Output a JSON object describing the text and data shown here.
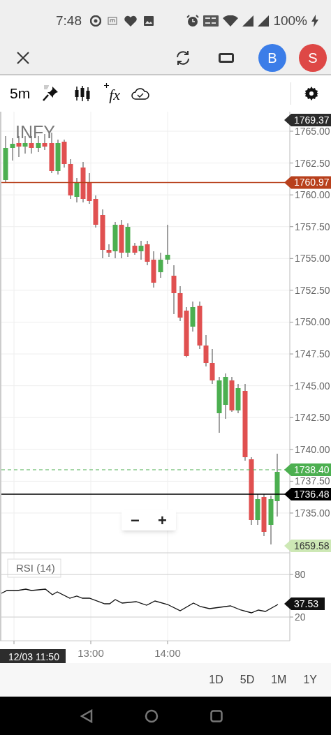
{
  "status_bar": {
    "time": "7:48",
    "battery": "100%"
  },
  "app_bar": {
    "avatars": [
      {
        "letter": "B",
        "color": "#3b7de8"
      },
      {
        "letter": "S",
        "color": "#de4846"
      }
    ]
  },
  "toolbar": {
    "interval": "5m",
    "indicators_label": "fx"
  },
  "chart": {
    "symbol": "INFY",
    "price_ticks": [
      "1765.00",
      "1762.50",
      "1760.00",
      "1757.50",
      "1755.00",
      "1752.50",
      "1750.00",
      "1747.50",
      "1745.00",
      "1742.50",
      "1740.00",
      "1737.50",
      "1735.00"
    ],
    "price_tags": [
      {
        "label": "1769.37",
        "kind": "plain",
        "color": "#2b2b2b"
      },
      {
        "label": "1760.97",
        "kind": "solid_line",
        "color": "#b8401c"
      },
      {
        "label": "1738.40",
        "kind": "dashed_line",
        "color": "#4caf50"
      },
      {
        "label": "1736.48",
        "kind": "solid_line",
        "color": "#000000"
      },
      {
        "label": "1659.58",
        "kind": "plain",
        "color": "#cde8b5"
      }
    ],
    "zoom_buttons": [
      "−",
      "+"
    ]
  },
  "rsi": {
    "label": "RSI (14)",
    "ticks": [
      "80",
      "20"
    ],
    "tag": "37.53"
  },
  "time_axis": {
    "cursor_label": "12/03 11:50",
    "ticks": [
      "13:00",
      "14:00"
    ]
  },
  "ranges": [
    "1D",
    "5D",
    "1M",
    "1Y"
  ]
}
